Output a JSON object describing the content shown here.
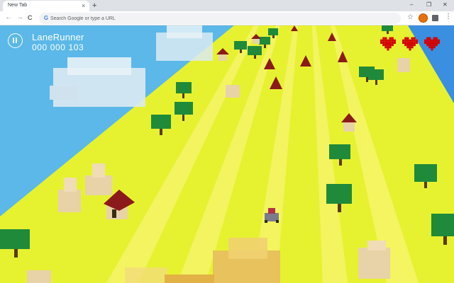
{
  "browser": {
    "tab": {
      "title": "New Tab",
      "close_glyph": "×"
    },
    "new_tab_glyph": "+",
    "window_controls": {
      "minimize": "–",
      "restore": "❐",
      "close": "✕"
    },
    "nav": {
      "back": "←",
      "forward": "→",
      "reload": "C"
    },
    "omnibox": {
      "placeholder": "Search Google or type a URL",
      "value": "",
      "icon": "google-g-icon"
    },
    "toolbar_icons": [
      "bookmark-star-icon",
      "profile-avatar-icon",
      "extensions-puzzle-icon",
      "menu-dots-icon"
    ],
    "star_glyph": "☆",
    "menu_glyph": "⋮"
  },
  "game": {
    "title": "LaneRunner",
    "score": "000 000 103",
    "lives": 3,
    "pause_icon": "pause-icon",
    "colors": {
      "ground": "#e6f230",
      "lane_light": "#f7f56a",
      "water": "#5bb8e8",
      "water_right": "#3a8fe0",
      "heart": "#d40000",
      "cloud": "#d8e9f2",
      "tree_leaf": "#1f8a3a",
      "roof": "#8b1a1a",
      "rock": "#e8d2a8"
    }
  }
}
